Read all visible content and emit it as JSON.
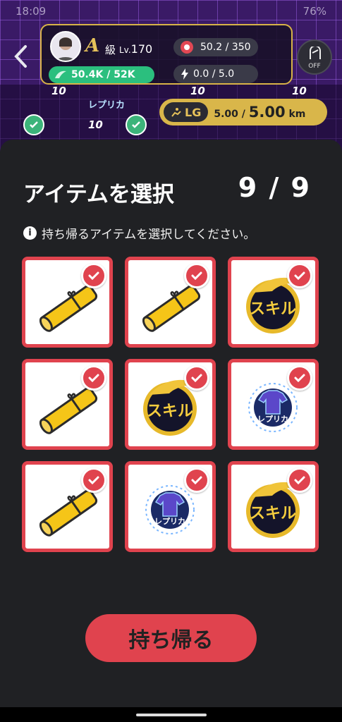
{
  "status_bar": {
    "time": "18:09",
    "battery": "76%"
  },
  "profile": {
    "rank_letter": "A",
    "rank_class": "級",
    "level_prefix": "Lv.",
    "level": "170",
    "coins": "50.4K / 52K",
    "energy": "50.2 / 350",
    "power": "0.0 / 5.0",
    "off_label": "OFF"
  },
  "distance": {
    "badge": "LG",
    "current": "5.00",
    "separator": " / ",
    "target": "5.00",
    "unit": "km"
  },
  "map_labels": {
    "reward_a": "10",
    "reward_b": "10",
    "reward_c": "10",
    "reward_d": "10",
    "reward_e": "10",
    "replica": "レプリカ"
  },
  "sheet": {
    "title": "アイテムを選択",
    "count": "9 / 9",
    "hint": "持ち帰るアイテムを選択してください。",
    "info_icon_text": "i",
    "take_button": "持ち帰る"
  },
  "items": [
    {
      "type": "scroll",
      "selected": true
    },
    {
      "type": "scroll",
      "selected": true
    },
    {
      "type": "skill",
      "label": "スキル",
      "selected": true
    },
    {
      "type": "scroll",
      "selected": true
    },
    {
      "type": "skill",
      "label": "スキル",
      "selected": true
    },
    {
      "type": "replica",
      "label": "レプリカ",
      "selected": true
    },
    {
      "type": "scroll",
      "selected": true
    },
    {
      "type": "replica",
      "label": "レプリカ",
      "selected": true
    },
    {
      "type": "skill",
      "label": "スキル",
      "selected": true
    }
  ],
  "colors": {
    "accent": "#e0434e",
    "gold": "#d9b64a",
    "green": "#2bbf7e",
    "sheet": "#202124"
  }
}
